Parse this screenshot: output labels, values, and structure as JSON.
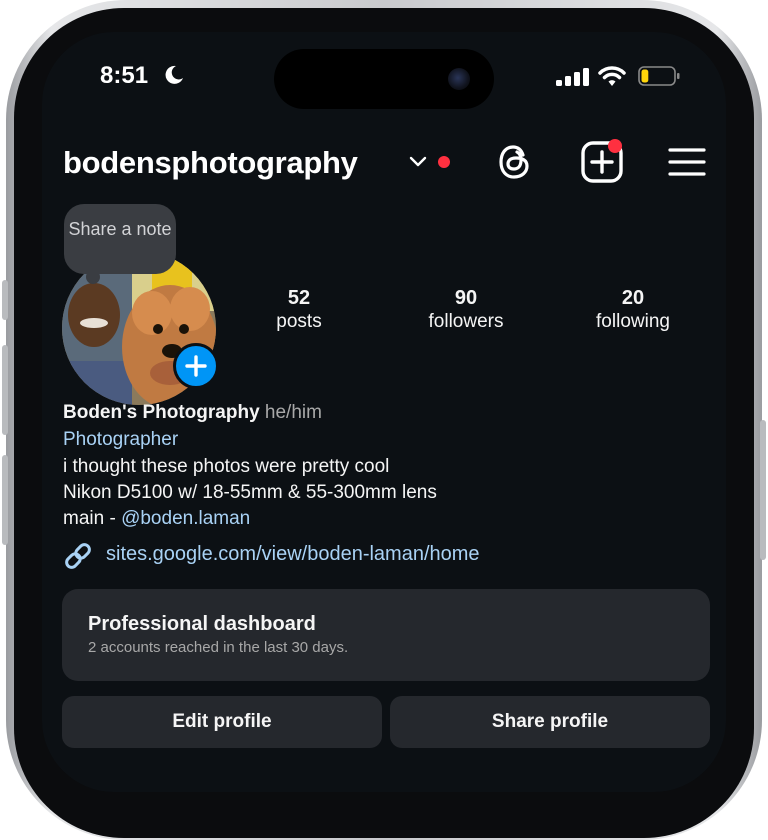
{
  "status_bar": {
    "time": "8:51",
    "icons": [
      "moon-icon",
      "cellular-signal-icon",
      "wifi-icon",
      "battery-icon"
    ],
    "battery_level": 0.22
  },
  "header": {
    "username": "bodensphotography",
    "icons": [
      "chevron-down-icon",
      "threads-icon",
      "new-post-icon",
      "menu-icon"
    ],
    "notification_color": "#ff3040"
  },
  "note": {
    "text": "Share a note"
  },
  "stats": [
    {
      "value": "52",
      "label": "posts"
    },
    {
      "value": "90",
      "label": "followers"
    },
    {
      "value": "20",
      "label": "following"
    }
  ],
  "bio": {
    "name": "Boden's Photography",
    "pronouns": "he/him",
    "category": "Photographer",
    "lines": [
      "i thought these photos were pretty cool",
      "Nikon D5100 w/ 18-55mm & 55-300mm lens"
    ],
    "mention_prefix": "main - ",
    "mention": "@boden.laman",
    "link": "sites.google.com/view/boden-laman/home"
  },
  "dashboard": {
    "title": "Professional dashboard",
    "subtitle": "2 accounts reached in the last 30 days."
  },
  "buttons": {
    "edit": "Edit profile",
    "share": "Share profile"
  },
  "colors": {
    "background": "#0c1014",
    "link": "#a9d2f5",
    "accent": "#0095f6",
    "card": "#25282d"
  }
}
